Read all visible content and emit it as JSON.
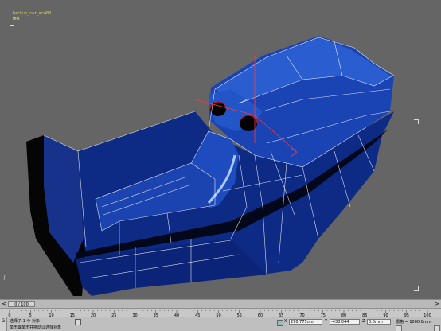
{
  "viewport": {
    "object_name": "backup_car_mc400",
    "object_sub": "MM2",
    "background": "#656565",
    "mesh_color": "#1b3fa0",
    "mesh_edge_color": "#ffffff"
  },
  "timeline": {
    "frame_label": "0 / 100",
    "prev_arrow": "<",
    "next_arrow": ">"
  },
  "ruler": {
    "ticks": [
      "0",
      "5",
      "10",
      "15",
      "20",
      "25",
      "30",
      "35",
      "40",
      "45",
      "50",
      "55",
      "60",
      "65",
      "70",
      "75",
      "80",
      "85",
      "90",
      "95",
      "100"
    ]
  },
  "status": {
    "left_button": "G",
    "message_top": "选择了 1 个 对象",
    "message_bottom": "单击或单击并拖动以选择对象",
    "x_label": "X",
    "x_value": "270.775mm",
    "y_label": "Y",
    "y_value": "-438.044",
    "z_label": "Z",
    "z_value": "0.0mm",
    "grid_label": "栅格 = 1000.0mm"
  }
}
